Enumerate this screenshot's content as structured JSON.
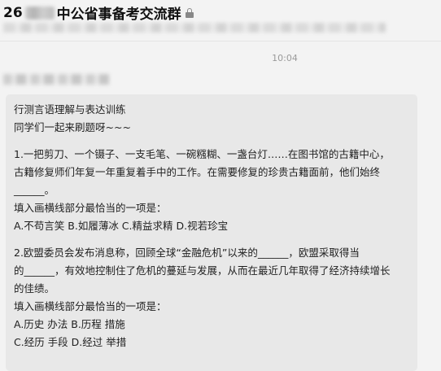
{
  "chat": {
    "title_prefix": "26",
    "title_name": "中公省事备考交流群",
    "time": "10:04"
  },
  "message": {
    "lines": [
      "行测言语理解与表达训练",
      "同学们一起来刷题呀~~~",
      "",
      "1.一把剪刀、一个镊子、一支毛笔、一碗糨糊、一盏台灯……在图书馆的古籍中心，",
      "古籍修复师们年复一年重复着手中的工作。在需要修复的珍贵古籍面前，他们始终",
      "______。",
      "填入画横线部分最恰当的一项是：",
      "A.不苟言笑 B.如履薄冰 C.精益求精 D.视若珍宝",
      "",
      "2.欧盟委员会发布消息称，回顾全球“金融危机”以来的______，欧盟采取得当",
      "的______，有效地控制住了危机的蔓延与发展，从而在最近几年取得了经济持续增长",
      "的佳绩。",
      "填入画横线部分最恰当的一项是：",
      "A.历史 办法 B.历程 措施",
      "C.经历 手段 D.经过 举措"
    ]
  }
}
